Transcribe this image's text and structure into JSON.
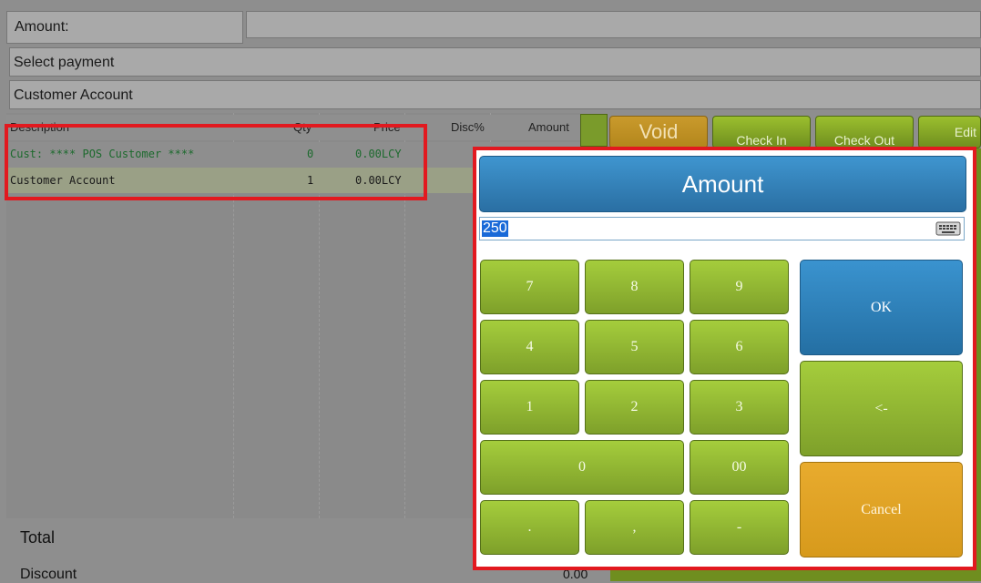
{
  "form": {
    "amount_label": "Amount:",
    "select_payment": "Select payment",
    "customer_account": "Customer Account"
  },
  "table": {
    "headers": [
      "Description",
      "Qty",
      "Price",
      "Disc%",
      "Amount"
    ],
    "rows": [
      {
        "description": "Cust: **** POS Customer ****",
        "qty": "0",
        "price": "0.00LCY"
      },
      {
        "description": "Customer Account",
        "qty": "1",
        "price": "0.00LCY"
      }
    ]
  },
  "totals": {
    "total_label": "Total",
    "discount_label": "Discount",
    "discount_value": "0.00"
  },
  "actions": {
    "void": "Void",
    "check_in": "Check In",
    "check_out": "Check Out",
    "edit": "Edit"
  },
  "dialog": {
    "title": "Amount",
    "input_value": "250",
    "keys": [
      "7",
      "8",
      "9",
      "4",
      "5",
      "6",
      "1",
      "2",
      "3",
      "0",
      "00",
      ".",
      ",",
      "-"
    ],
    "ok": "OK",
    "backspace": "<-",
    "cancel": "Cancel"
  },
  "colors": {
    "ok_blue": "#2f7fb5",
    "cancel_orange": "#e1a228",
    "key_green": "#8fb534",
    "highlight_red": "#e2191f"
  }
}
